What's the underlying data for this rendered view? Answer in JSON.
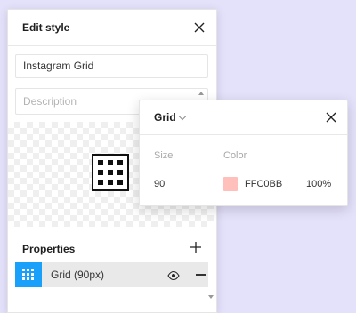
{
  "panel": {
    "title": "Edit style",
    "name_value": "Instagram Grid",
    "description_placeholder": "Description",
    "properties_label": "Properties",
    "grid_item_label": "Grid (90px)"
  },
  "popover": {
    "type_label": "Grid",
    "size_label": "Size",
    "color_label": "Color",
    "size_value": "90",
    "color_hex": "FFC0BB",
    "opacity": "100%"
  },
  "colors": {
    "background": "#e4e1fb",
    "accent": "#18a0fb",
    "grid_color": "#ffc0bb"
  },
  "icons": [
    "close-icon",
    "grid-icon",
    "plus-icon",
    "eye-icon",
    "minus-icon",
    "chevron-down-icon"
  ]
}
